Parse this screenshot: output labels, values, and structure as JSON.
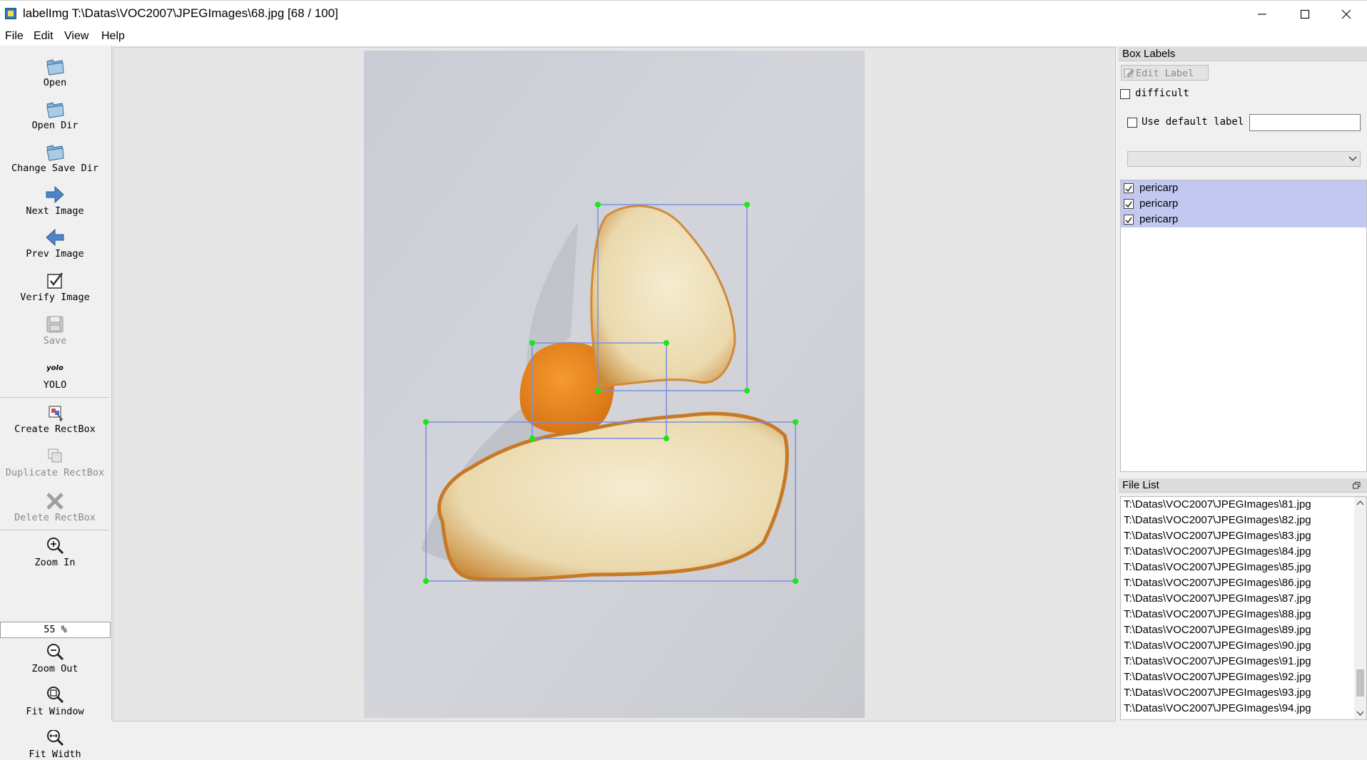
{
  "window": {
    "title": "labelImg T:\\Datas\\VOC2007\\JPEGImages\\68.jpg [68 / 100]",
    "controls": [
      "minimize",
      "maximize",
      "close"
    ]
  },
  "menu": [
    "File",
    "Edit",
    "View",
    "Help"
  ],
  "toolbar": {
    "open": "Open",
    "open_dir": "Open Dir",
    "change_save_dir": "Change Save Dir",
    "next_image": "Next Image",
    "prev_image": "Prev Image",
    "verify_image": "Verify Image",
    "save": "Save",
    "format_icon_text": "yolo",
    "format": "YOLO",
    "create_rectbox": "Create RectBox",
    "duplicate_rectbox": "Duplicate RectBox",
    "delete_rectbox": "Delete RectBox",
    "zoom_in": "Zoom In",
    "zoom_value": "55 %",
    "zoom_out": "Zoom Out",
    "fit_window": "Fit Window",
    "fit_width": "Fit Width"
  },
  "box_labels": {
    "title": "Box Labels",
    "edit_label": "Edit Label",
    "difficult": "difficult",
    "use_default_label": "Use default label",
    "default_label_value": "",
    "labels": [
      {
        "name": "pericarp",
        "checked": true
      },
      {
        "name": "pericarp",
        "checked": true
      },
      {
        "name": "pericarp",
        "checked": true
      }
    ]
  },
  "file_list": {
    "title": "File List",
    "items": [
      "T:\\Datas\\VOC2007\\JPEGImages\\81.jpg",
      "T:\\Datas\\VOC2007\\JPEGImages\\82.jpg",
      "T:\\Datas\\VOC2007\\JPEGImages\\83.jpg",
      "T:\\Datas\\VOC2007\\JPEGImages\\84.jpg",
      "T:\\Datas\\VOC2007\\JPEGImages\\85.jpg",
      "T:\\Datas\\VOC2007\\JPEGImages\\86.jpg",
      "T:\\Datas\\VOC2007\\JPEGImages\\87.jpg",
      "T:\\Datas\\VOC2007\\JPEGImages\\88.jpg",
      "T:\\Datas\\VOC2007\\JPEGImages\\89.jpg",
      "T:\\Datas\\VOC2007\\JPEGImages\\90.jpg",
      "T:\\Datas\\VOC2007\\JPEGImages\\91.jpg",
      "T:\\Datas\\VOC2007\\JPEGImages\\92.jpg",
      "T:\\Datas\\VOC2007\\JPEGImages\\93.jpg",
      "T:\\Datas\\VOC2007\\JPEGImages\\94.jpg"
    ]
  },
  "colors": {
    "box_stroke": "#7b8fe0",
    "handle": "#18e818",
    "label_selected_bg": "#c3c8f0"
  }
}
